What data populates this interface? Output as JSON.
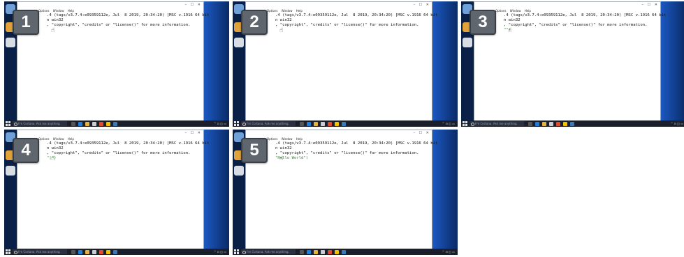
{
  "frames": [
    {
      "step": "1",
      "menu": [
        "Options",
        "Window",
        "Help"
      ],
      "line1": ".4 (tags/v3.7.4:e09359112e, Jul  8 2019, 20:34:20) [MSC v.1916 64 bit",
      "line2": "n win32",
      "line3": ", \"copyright\", \"credits\" or \"license()\" for more information.",
      "line4": "",
      "search": "I'm Cortana. Ask me anything."
    },
    {
      "step": "2",
      "menu": [
        "Options",
        "Window",
        "Help"
      ],
      "line1": ".4 (tags/v3.7.4:e09359112e, Jul  8 2019, 20:34:20) [MSC v.1916 64 bit",
      "line2": "n win32",
      "line3": ", \"copyright\", \"credits\" or \"license()\" for more information.",
      "line4": "",
      "search": "I'm Cortana. Ask me anything."
    },
    {
      "step": "3",
      "menu": [
        "Options",
        "Window",
        "Help"
      ],
      "line1": ".4 (tags/v3.7.4:e09359112e, Jul  8 2019, 20:34:20) [MSC v.1916 64 bit",
      "line2": "n win32",
      "line3": ", \"copyright\", \"credits\" or \"license()\" for more information.",
      "line4": "\"\")",
      "search": "I'm Cortana. Ask me anything."
    },
    {
      "step": "4",
      "menu": [
        "Options",
        "Window",
        "Help"
      ],
      "line1": ".4 (tags/v3.7.4:e09359112e, Jul  8 2019, 20:34:20) [MSC v.1916 64 bit",
      "line2": "n win32",
      "line3": ", \"copyright\", \"credits\" or \"license()\" for more information.",
      "line4": "\"|\")",
      "search": "I'm Cortana. Ask me anything."
    },
    {
      "step": "5",
      "menu": [
        "Options",
        "Window",
        "Help"
      ],
      "line1": ".4 (tags/v3.7.4:e09359112e, Jul  8 2019, 20:34:20) [MSC v.1916 64 bit",
      "line2": "n win32",
      "line3": ", \"copyright\", \"credits\" or \"license()\" for more information.",
      "line4": "\"Hello World\")",
      "search": "I'm Cortana. Ask me anything."
    }
  ],
  "colors": {
    "badge": "#5f666e",
    "desktop": "#0f3474",
    "taskbar": "#1a1f2b",
    "string": "#2a8a2a"
  }
}
